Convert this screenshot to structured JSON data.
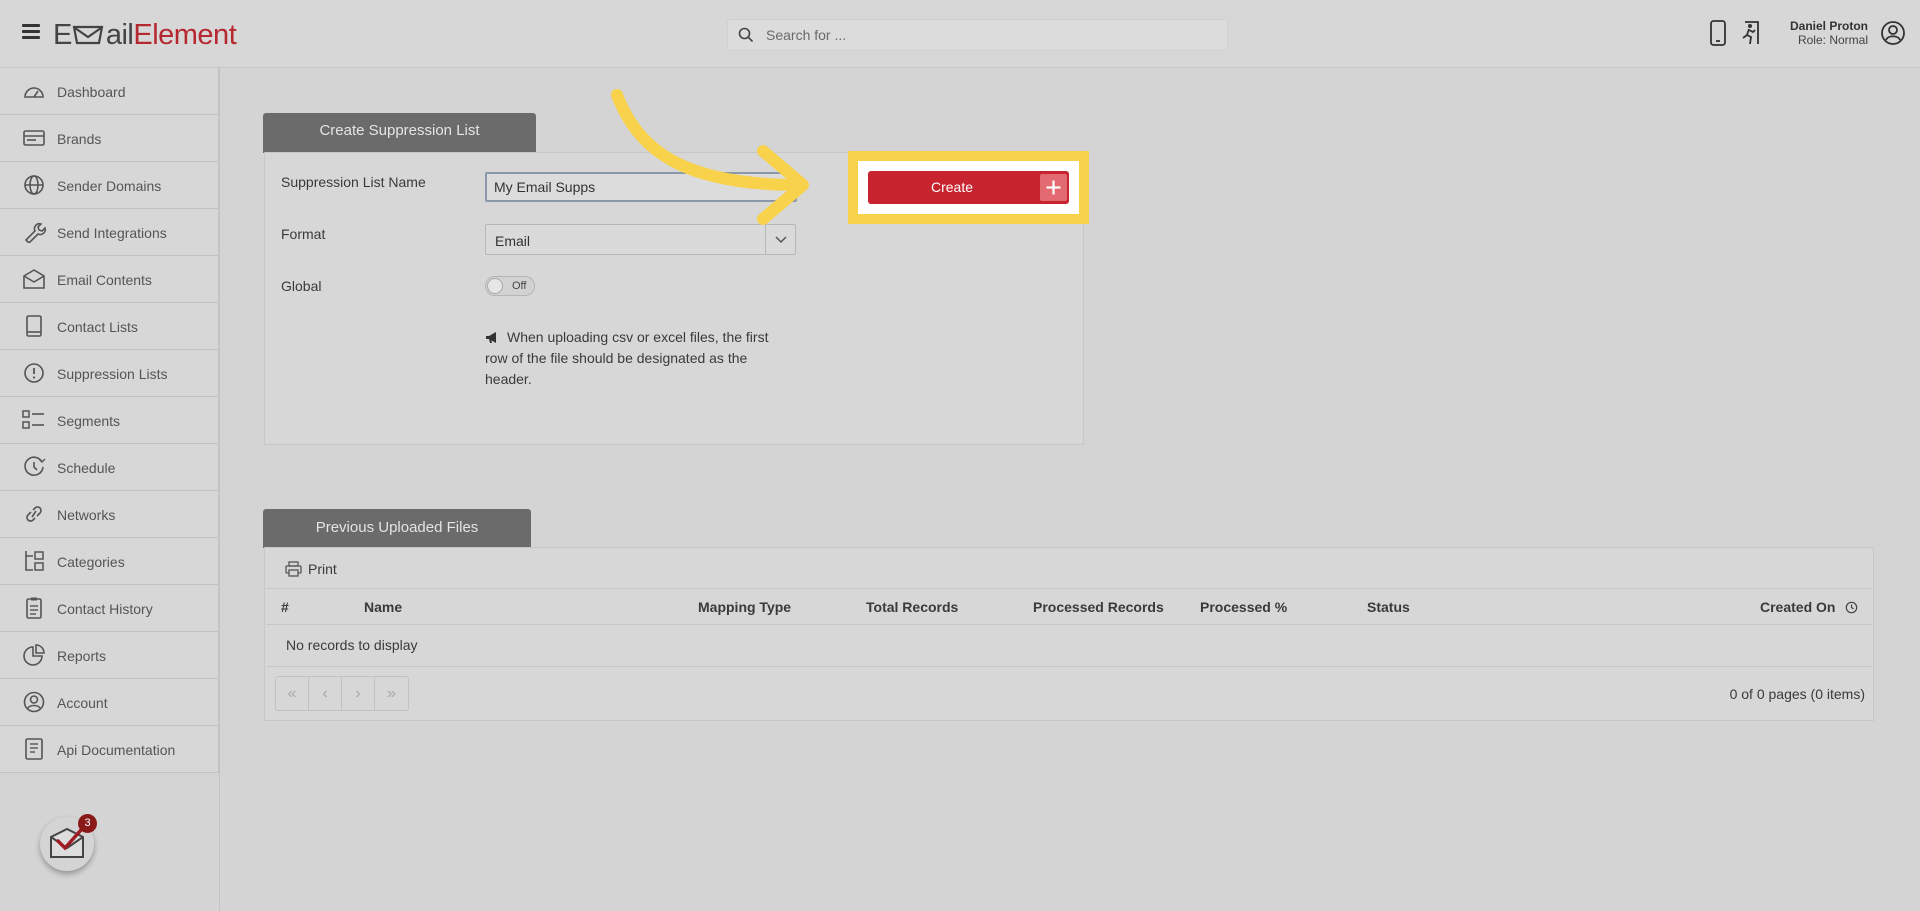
{
  "header": {
    "logo_part1": "E",
    "logo_mail": "m",
    "logo_part2": "ail",
    "logo_part3": "Element",
    "search_placeholder": "Search for ...",
    "user_name": "Daniel Proton",
    "user_role": "Role: Normal"
  },
  "sidebar": {
    "items": [
      {
        "label": "Dashboard",
        "icon": "dashboard-icon"
      },
      {
        "label": "Brands",
        "icon": "brands-icon"
      },
      {
        "label": "Sender Domains",
        "icon": "globe-icon"
      },
      {
        "label": "Send Integrations",
        "icon": "wrench-icon"
      },
      {
        "label": "Email Contents",
        "icon": "envelope-icon"
      },
      {
        "label": "Contact Lists",
        "icon": "book-icon"
      },
      {
        "label": "Suppression Lists",
        "icon": "exclamation-icon"
      },
      {
        "label": "Segments",
        "icon": "list-icon"
      },
      {
        "label": "Schedule",
        "icon": "clock-icon"
      },
      {
        "label": "Networks",
        "icon": "link-icon"
      },
      {
        "label": "Categories",
        "icon": "categories-icon"
      },
      {
        "label": "Contact History",
        "icon": "clipboard-icon"
      },
      {
        "label": "Reports",
        "icon": "pie-chart-icon"
      },
      {
        "label": "Account",
        "icon": "user-circle-icon"
      },
      {
        "label": "Api Documentation",
        "icon": "document-icon"
      }
    ],
    "notification_count": "3"
  },
  "create_panel": {
    "tab_label": "Create Suppression List",
    "name_label": "Suppression List Name",
    "name_value": "My Email Supps",
    "format_label": "Format",
    "format_value": "Email",
    "global_label": "Global",
    "global_state": "Off",
    "note": "When uploading csv or excel files, the first row of the file should be designated as the header.",
    "create_button": "Create"
  },
  "files_panel": {
    "tab_label": "Previous Uploaded Files",
    "print_label": "Print",
    "columns": [
      "#",
      "Name",
      "Mapping Type",
      "Total Records",
      "Processed Records",
      "Processed %",
      "Status",
      "Created On"
    ],
    "empty_message": "No records to display",
    "pager_buttons": [
      "«",
      "‹",
      "›",
      "»"
    ],
    "page_info": "0 of 0 pages (0 items)"
  },
  "colors": {
    "accent": "#c8242f",
    "highlight": "#f8d24a",
    "tab_background": "#6b6b6b"
  }
}
